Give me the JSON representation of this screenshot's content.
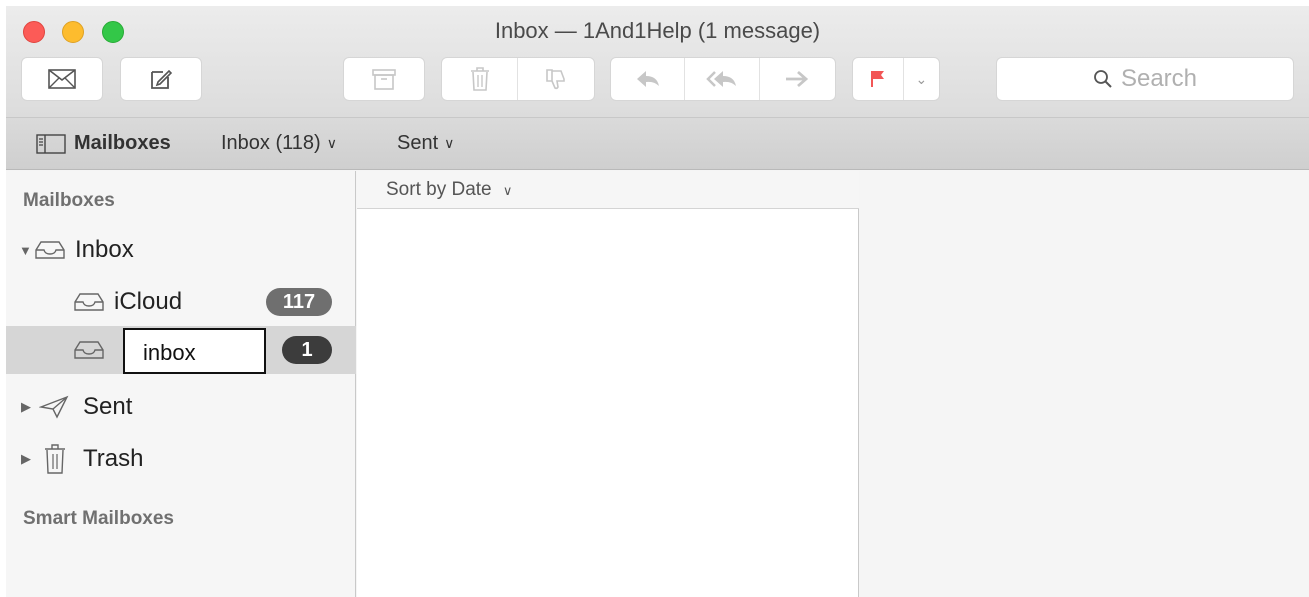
{
  "window": {
    "title": "Inbox — 1And1Help (1 message)"
  },
  "toolbar": {
    "get_mail_icon": "envelope-icon",
    "compose_icon": "compose-icon",
    "search_placeholder": "Search"
  },
  "favorites": {
    "mailboxes_label": "Mailboxes",
    "inbox_label": "Inbox (118)",
    "sent_label": "Sent"
  },
  "sidebar": {
    "mailboxes_heading": "Mailboxes",
    "inbox_label": "Inbox",
    "icloud_label": "iCloud",
    "icloud_count": "117",
    "account_rename_value": "inbox",
    "account_count": "1",
    "sent_label": "Sent",
    "trash_label": "Trash",
    "smart_heading": "Smart Mailboxes"
  },
  "message_list": {
    "sort_label": "Sort by Date"
  },
  "colors": {
    "flag": "#f25656",
    "badge": "#6f6f6f",
    "badge_selected": "#3c3c3c"
  }
}
